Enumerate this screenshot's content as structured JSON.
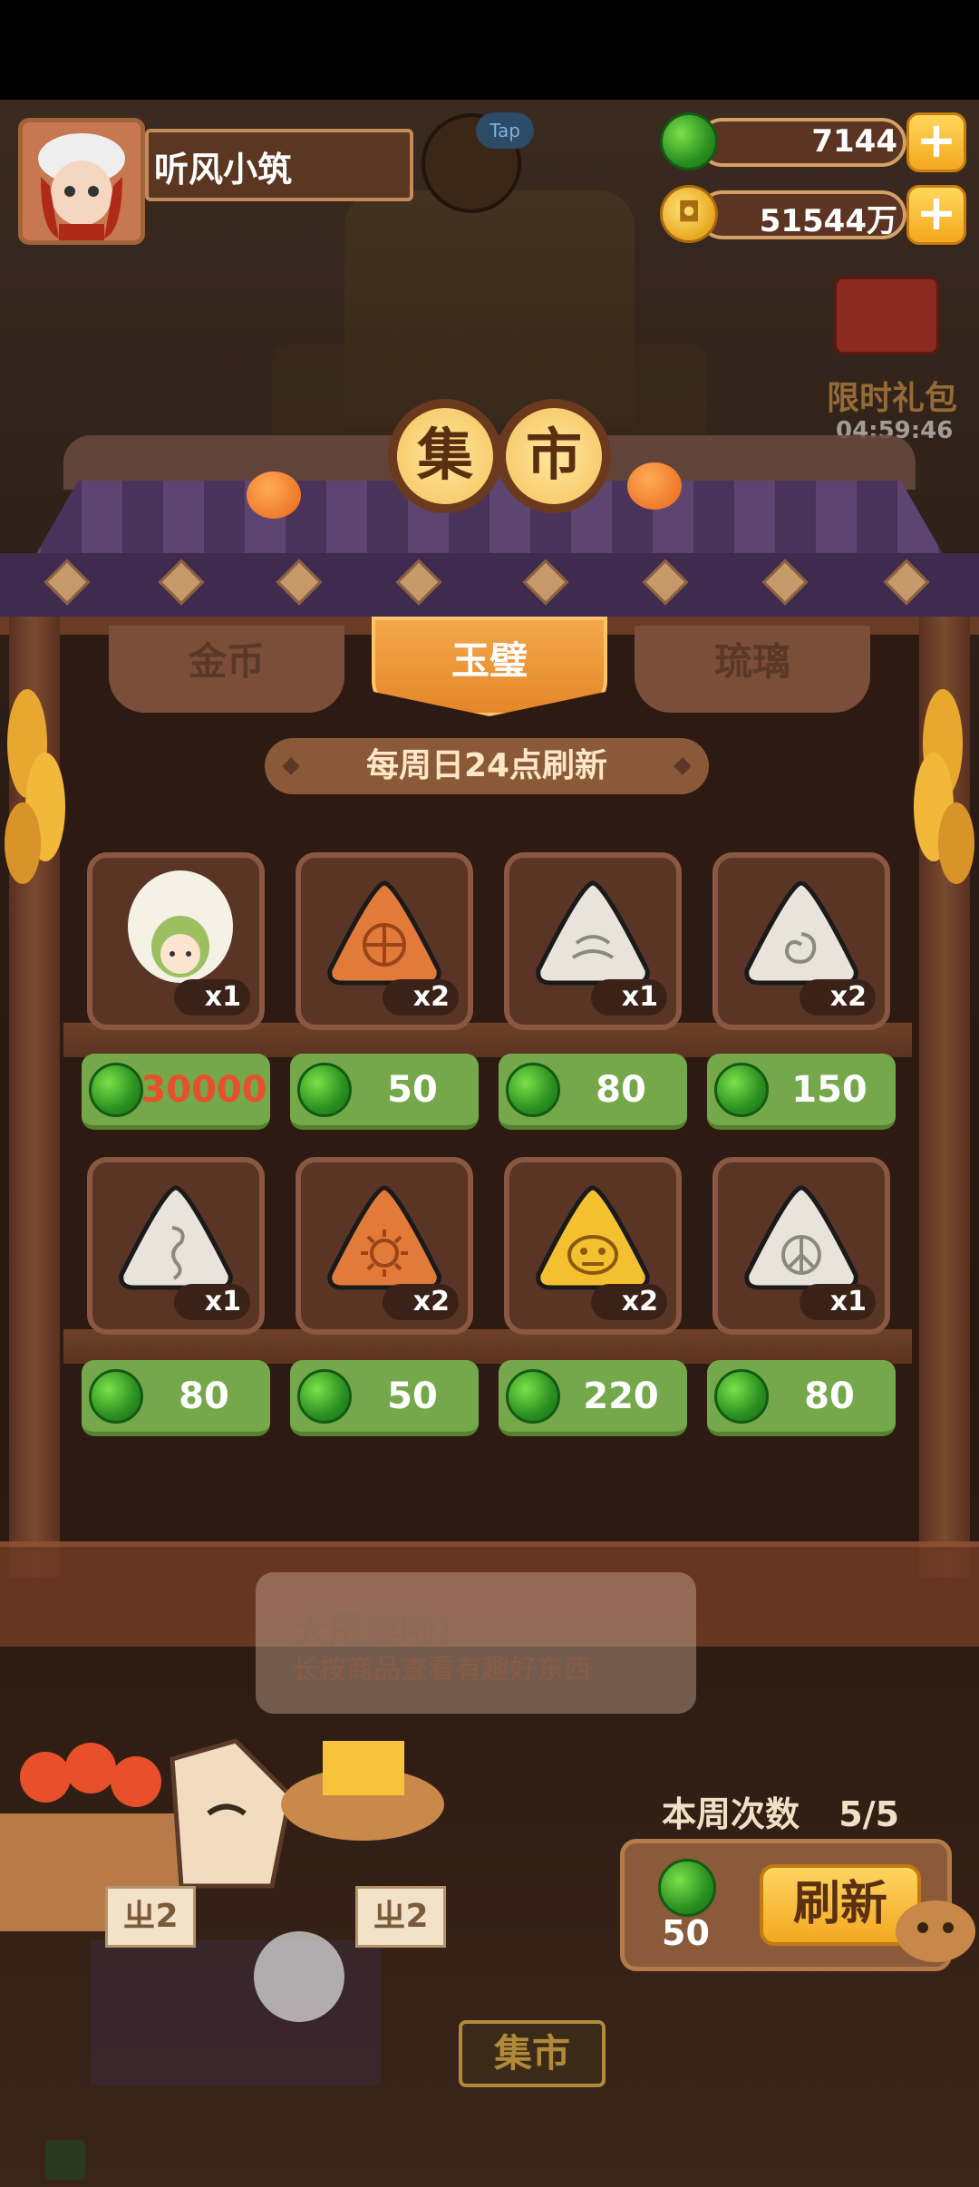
{
  "player": {
    "name": "听风小筑",
    "tap_label": "Tap"
  },
  "currency": {
    "jade": "7144",
    "gold": "51544万"
  },
  "gift": {
    "label": "限时礼包",
    "timer": "04:59:46"
  },
  "title": {
    "char1": "集",
    "char2": "市"
  },
  "tabs": [
    {
      "label": "金币",
      "active": false
    },
    {
      "label": "玉璧",
      "active": true
    },
    {
      "label": "琉璃",
      "active": false
    }
  ],
  "refresh_notice": "每周日24点刷新",
  "items": [
    {
      "icon": "character-card-icon",
      "qty": "x1",
      "price": "30000",
      "price_color": "#e8502c"
    },
    {
      "icon": "orange-jade-wheel-icon",
      "qty": "x2",
      "price": "50"
    },
    {
      "icon": "white-jade-wave-icon",
      "qty": "x1",
      "price": "80"
    },
    {
      "icon": "white-jade-spiral-icon",
      "qty": "x2",
      "price": "150"
    },
    {
      "icon": "white-jade-snake-icon",
      "qty": "x1",
      "price": "80"
    },
    {
      "icon": "orange-jade-sun-icon",
      "qty": "x2",
      "price": "50"
    },
    {
      "icon": "gold-jade-face-icon",
      "qty": "x2",
      "price": "220"
    },
    {
      "icon": "white-jade-leaf-icon",
      "qty": "x1",
      "price": "80"
    }
  ],
  "bubble": {
    "line1": "大甩卖啦!",
    "line2": "长按商品查看有趣好东西"
  },
  "weekly": {
    "label": "本周次数",
    "count": "5/5"
  },
  "refresh": {
    "cost": "50",
    "button": "刷新"
  },
  "stall": {
    "tag1": "ㄓ2",
    "tag2": "ㄓ2",
    "sign": "集市"
  },
  "colors": {
    "jade_green": "#2a9020",
    "price_green": "#74a84a",
    "accent_gold": "#f5c25a"
  }
}
